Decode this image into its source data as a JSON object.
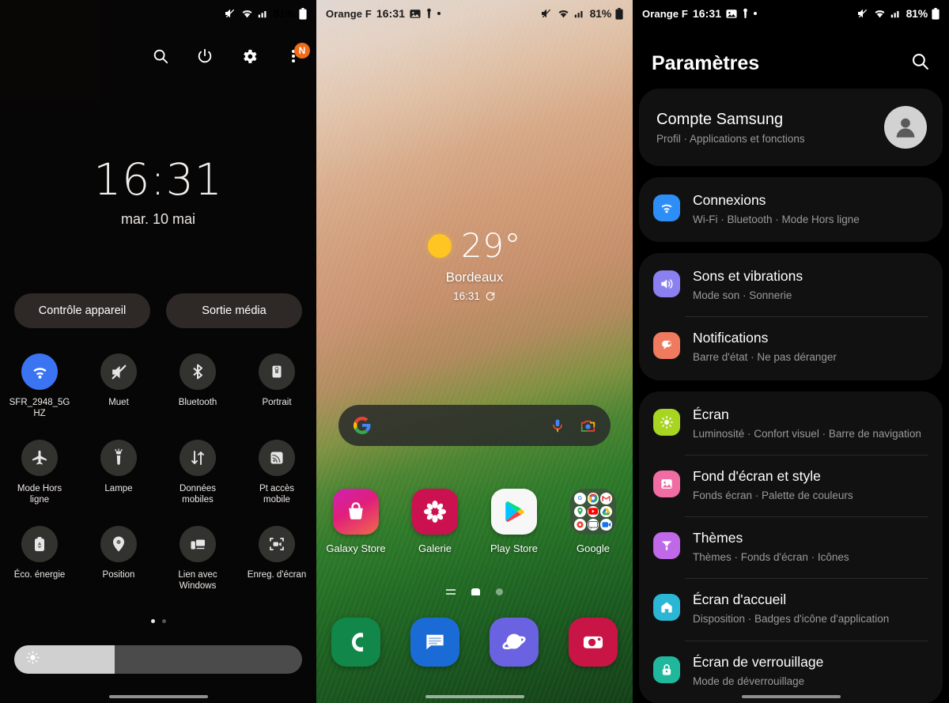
{
  "statusbar": {
    "carrier": "Orange F",
    "time": "16:31",
    "battery": "81%",
    "icons": [
      "image-icon",
      "vpn-key-icon",
      "dot-icon",
      "mute-icon",
      "wifi-icon",
      "signal-icon",
      "battery-icon"
    ]
  },
  "quick_panel": {
    "top_buttons": [
      {
        "name": "search-icon",
        "label": "Rechercher"
      },
      {
        "name": "power-icon",
        "label": "Alimentation"
      },
      {
        "name": "gear-icon",
        "label": "Paramètres"
      },
      {
        "name": "more-icon",
        "label": "Plus",
        "badge": "N"
      }
    ],
    "clock": {
      "time": "16:31",
      "date": "mar. 10 mai"
    },
    "pills": [
      {
        "label": "Contrôle appareil"
      },
      {
        "label": "Sortie média"
      }
    ],
    "tiles": [
      {
        "label": "SFR_2948_5G HZ",
        "icon": "wifi-icon",
        "active": true
      },
      {
        "label": "Muet",
        "icon": "mute-icon",
        "active": false
      },
      {
        "label": "Bluetooth",
        "icon": "bluetooth-icon",
        "active": false
      },
      {
        "label": "Portrait",
        "icon": "rotation-lock-icon",
        "active": false
      },
      {
        "label": "Mode Hors ligne",
        "icon": "airplane-icon",
        "active": false
      },
      {
        "label": "Lampe",
        "icon": "flashlight-icon",
        "active": false
      },
      {
        "label": "Données mobiles",
        "icon": "data-transfer-icon",
        "active": false
      },
      {
        "label": "Pt accès mobile",
        "icon": "hotspot-icon",
        "active": false
      },
      {
        "label": "Éco. énergie",
        "icon": "battery-saver-icon",
        "active": false
      },
      {
        "label": "Position",
        "icon": "location-pin-icon",
        "active": false
      },
      {
        "label": "Lien avec Windows",
        "icon": "link-to-windows-icon",
        "active": false
      },
      {
        "label": "Enreg. d'écran",
        "icon": "screen-record-icon",
        "active": false
      }
    ],
    "pager": {
      "pages": 2,
      "current": 1
    },
    "brightness": {
      "value_percent": 35,
      "icon": "brightness-icon",
      "more": "brightness-options-icon"
    }
  },
  "home_screen": {
    "weather": {
      "temperature": "29°",
      "city": "Bordeaux",
      "time": "16:31",
      "condition_icon": "sunny-icon",
      "refresh_icon": "refresh-icon"
    },
    "search_bar": {
      "google_icon": "google-g-icon",
      "mic_icon": "microphone-icon",
      "lens_icon": "google-lens-icon",
      "placeholder": ""
    },
    "apps": [
      {
        "label": "Galaxy Store",
        "icon": "galaxy-store-icon",
        "color": "#e0217a"
      },
      {
        "label": "Galerie",
        "icon": "gallery-icon",
        "color": "#cc1150"
      },
      {
        "label": "Play Store",
        "icon": "play-store-icon",
        "color": "#ffffff"
      },
      {
        "label": "Google",
        "icon": "google-folder-icon",
        "color": "#464646"
      }
    ],
    "folder_apps": [
      "Google",
      "Chrome",
      "Gmail",
      "Maps",
      "YouTube",
      "Drive",
      "Photos",
      "Meet",
      "Duo"
    ],
    "pager": {
      "apps_icon": "app-list-icon",
      "home_icon": "home-icon",
      "pages": 2,
      "current": 1
    },
    "dock": [
      {
        "label": "Téléphone",
        "icon": "phone-icon",
        "color": "#12874a"
      },
      {
        "label": "Messages",
        "icon": "messages-icon",
        "color": "#1b6bd6"
      },
      {
        "label": "Internet",
        "icon": "samsung-internet-icon",
        "color": "#6a62e0"
      },
      {
        "label": "Appareil photo",
        "icon": "camera-icon",
        "color": "#c91545"
      }
    ]
  },
  "settings": {
    "title": "Paramètres",
    "search_icon": "search-icon",
    "account": {
      "title": "Compte Samsung",
      "subtitle": "Profil  ·  Applications et fonctions",
      "avatar": "avatar-icon"
    },
    "groups": [
      {
        "items": [
          {
            "title": "Connexions",
            "subtitle": "Wi-Fi  ·  Bluetooth  ·  Mode Hors ligne",
            "icon": "wifi-icon",
            "color": "#2e8ef7"
          }
        ]
      },
      {
        "items": [
          {
            "title": "Sons et vibrations",
            "subtitle": "Mode son  ·  Sonnerie",
            "icon": "volume-icon",
            "color": "#8b80f0"
          },
          {
            "title": "Notifications",
            "subtitle": "Barre d'état  ·  Ne pas déranger",
            "icon": "notification-icon",
            "color": "#ef7a5e"
          }
        ]
      },
      {
        "items": [
          {
            "title": "Écran",
            "subtitle": "Luminosité  ·  Confort visuel  ·  Barre de navigation",
            "icon": "brightness-icon",
            "color": "#a8d620"
          },
          {
            "title": "Fond d'écran et style",
            "subtitle": "Fonds écran  ·  Palette de couleurs",
            "icon": "wallpaper-icon",
            "color": "#f06ca3"
          },
          {
            "title": "Thèmes",
            "subtitle": "Thèmes  ·  Fonds d'écran  ·  Icônes",
            "icon": "themes-icon",
            "color": "#c069e8"
          },
          {
            "title": "Écran d'accueil",
            "subtitle": "Disposition  ·  Badges d'icône d'application",
            "icon": "home-icon",
            "color": "#2ab6d4"
          },
          {
            "title": "Écran de verrouillage",
            "subtitle": "Mode de déverrouillage",
            "icon": "lock-icon",
            "color": "#20b89c"
          }
        ]
      }
    ]
  }
}
